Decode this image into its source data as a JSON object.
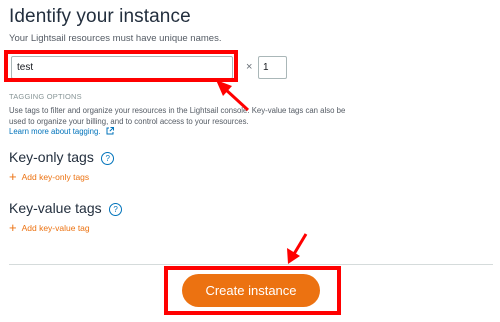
{
  "instance": {
    "title": "Identify your instance",
    "subtitle": "Your Lightsail resources must have unique names.",
    "name_value": "test",
    "times_symbol": "×",
    "count_value": "1"
  },
  "tagging": {
    "header": "TAGGING OPTIONS",
    "description": "Use tags to filter and organize your resources in the Lightsail console. Key-value tags can also be used to organize your billing, and to control access to your resources.",
    "learn_more": "Learn more about tagging."
  },
  "key_only": {
    "title": "Key-only tags",
    "help": "?",
    "add_label": "Add key-only tags",
    "add_symbol": "+"
  },
  "key_value": {
    "title": "Key-value tags",
    "help": "?",
    "add_label": "Add key-value tag",
    "add_symbol": "+"
  },
  "actions": {
    "create_label": "Create instance"
  },
  "colors": {
    "accent": "#ec7211",
    "link": "#0073bb",
    "annotation": "#ff0000"
  }
}
